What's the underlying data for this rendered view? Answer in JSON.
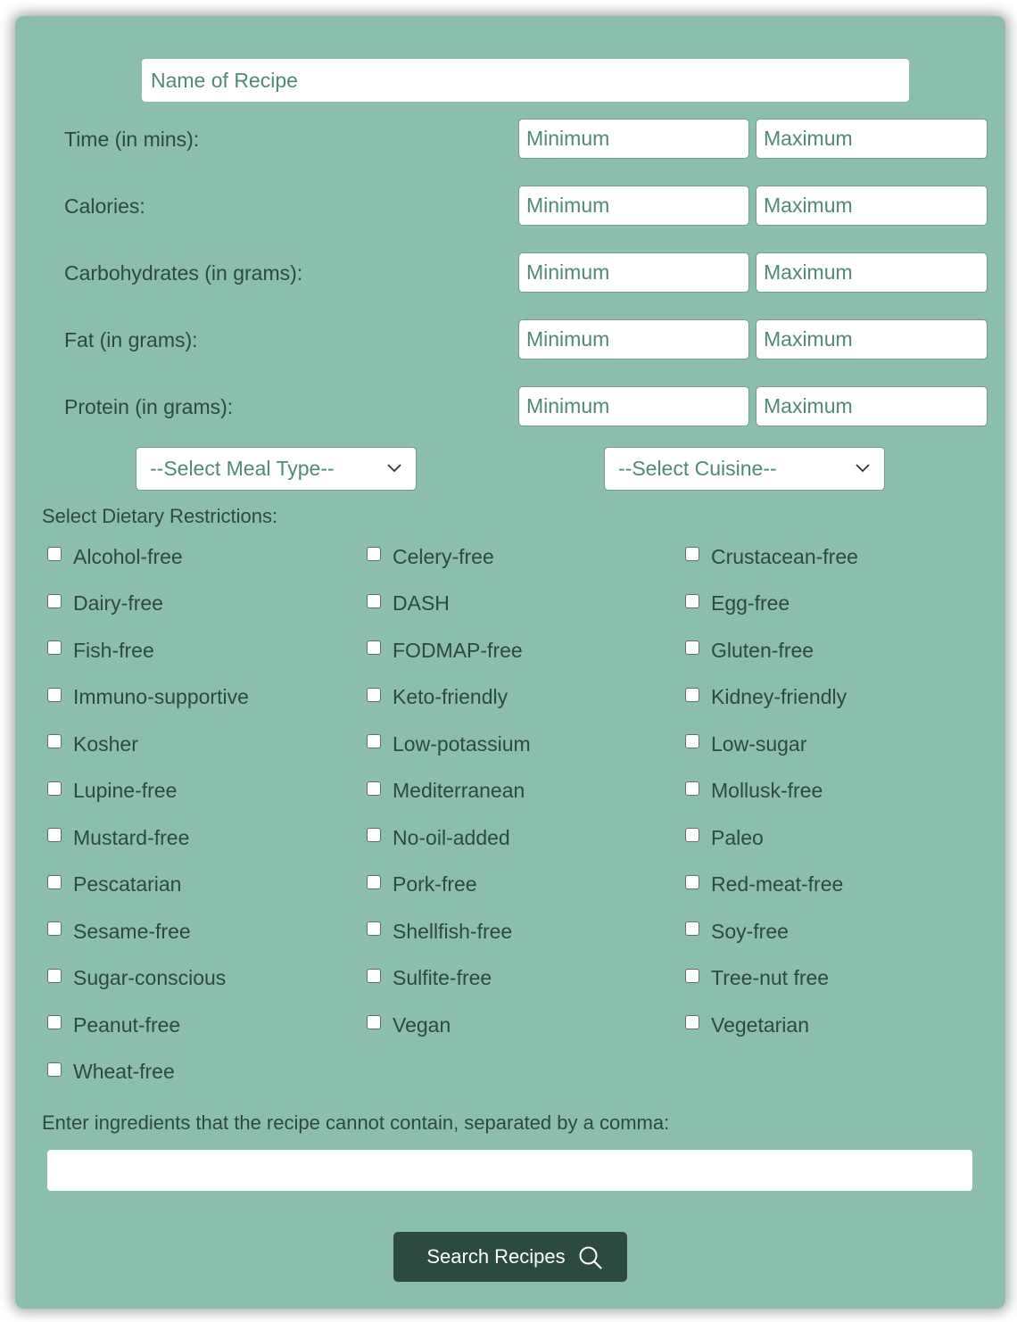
{
  "form": {
    "recipe_name_placeholder": "Name of Recipe",
    "ranges": [
      {
        "label": "Time (in mins):",
        "min_placeholder": "Minimum",
        "max_placeholder": "Maximum"
      },
      {
        "label": "Calories:",
        "min_placeholder": "Minimum",
        "max_placeholder": "Maximum"
      },
      {
        "label": "Carbohydrates (in grams):",
        "min_placeholder": "Minimum",
        "max_placeholder": "Maximum"
      },
      {
        "label": "Fat (in grams):",
        "min_placeholder": "Minimum",
        "max_placeholder": "Maximum"
      },
      {
        "label": "Protein (in grams):",
        "min_placeholder": "Minimum",
        "max_placeholder": "Maximum"
      }
    ],
    "meal_type_select": {
      "selected": "--Select Meal Type--",
      "icon": "chevron-down-icon"
    },
    "cuisine_select": {
      "selected": "--Select Cuisine--",
      "icon": "chevron-down-icon"
    },
    "dietary_label": "Select Dietary Restrictions:",
    "dietary_options": [
      {
        "label": "Alcohol-free",
        "checked": false
      },
      {
        "label": "Celery-free",
        "checked": false
      },
      {
        "label": "Crustacean-free",
        "checked": false
      },
      {
        "label": "Dairy-free",
        "checked": false
      },
      {
        "label": "DASH",
        "checked": false
      },
      {
        "label": "Egg-free",
        "checked": false
      },
      {
        "label": "Fish-free",
        "checked": false
      },
      {
        "label": "FODMAP-free",
        "checked": false
      },
      {
        "label": "Gluten-free",
        "checked": false
      },
      {
        "label": "Immuno-supportive",
        "checked": false
      },
      {
        "label": "Keto-friendly",
        "checked": false
      },
      {
        "label": "Kidney-friendly",
        "checked": false
      },
      {
        "label": "Kosher",
        "checked": false
      },
      {
        "label": "Low-potassium",
        "checked": false
      },
      {
        "label": "Low-sugar",
        "checked": false
      },
      {
        "label": "Lupine-free",
        "checked": false
      },
      {
        "label": "Mediterranean",
        "checked": false
      },
      {
        "label": "Mollusk-free",
        "checked": false
      },
      {
        "label": "Mustard-free",
        "checked": false
      },
      {
        "label": "No-oil-added",
        "checked": false
      },
      {
        "label": "Paleo",
        "checked": false
      },
      {
        "label": "Pescatarian",
        "checked": false
      },
      {
        "label": "Pork-free",
        "checked": false
      },
      {
        "label": "Red-meat-free",
        "checked": false
      },
      {
        "label": "Sesame-free",
        "checked": false
      },
      {
        "label": "Shellfish-free",
        "checked": false
      },
      {
        "label": "Soy-free",
        "checked": false
      },
      {
        "label": "Sugar-conscious",
        "checked": false
      },
      {
        "label": "Sulfite-free",
        "checked": false
      },
      {
        "label": "Tree-nut free",
        "checked": false
      },
      {
        "label": "Peanut-free",
        "checked": false
      },
      {
        "label": "Vegan",
        "checked": false
      },
      {
        "label": "Vegetarian",
        "checked": false
      },
      {
        "label": "Wheat-free",
        "checked": false
      }
    ],
    "exclude_label": "Enter ingredients that the recipe cannot contain, separated by a comma:",
    "exclude_value": "",
    "search_button": {
      "label": "Search Recipes",
      "icon": "search-icon"
    }
  },
  "colors": {
    "card_background": "#8bbeac",
    "button_background": "#2c4a3e",
    "placeholder_text": "#4f8a72",
    "label_text": "#2d4a3f"
  }
}
